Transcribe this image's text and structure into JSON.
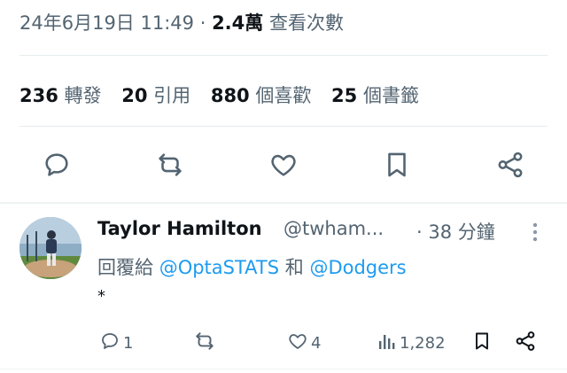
{
  "tweet_meta": {
    "timestamp": "24年6月19日 11:49",
    "separator": "·",
    "views_count": "2.4萬",
    "views_label": "查看次數"
  },
  "stats": [
    {
      "count": "236",
      "label": "轉發"
    },
    {
      "count": "20",
      "label": "引用"
    },
    {
      "count": "880",
      "label": "個喜歡"
    },
    {
      "count": "25",
      "label": "個書籤"
    }
  ],
  "actions": {
    "icons": [
      "reply-icon",
      "repost-icon",
      "like-icon",
      "bookmark-icon",
      "share-icon"
    ]
  },
  "reply": {
    "author_name": "Taylor Hamilton",
    "author_handle": "@twham...",
    "time": "· 38 分鐘",
    "reply_prefix": "回覆給",
    "mention_1": "@OptaSTATS",
    "conjunction": "和",
    "mention_2": "@Dodgers",
    "text": "*",
    "reply_count": "1",
    "like_count": "4",
    "views": "1,282"
  },
  "colors": {
    "accent": "#1d9bf0",
    "muted": "#536471",
    "text": "#0f1419",
    "divider": "#e6ecf0"
  }
}
